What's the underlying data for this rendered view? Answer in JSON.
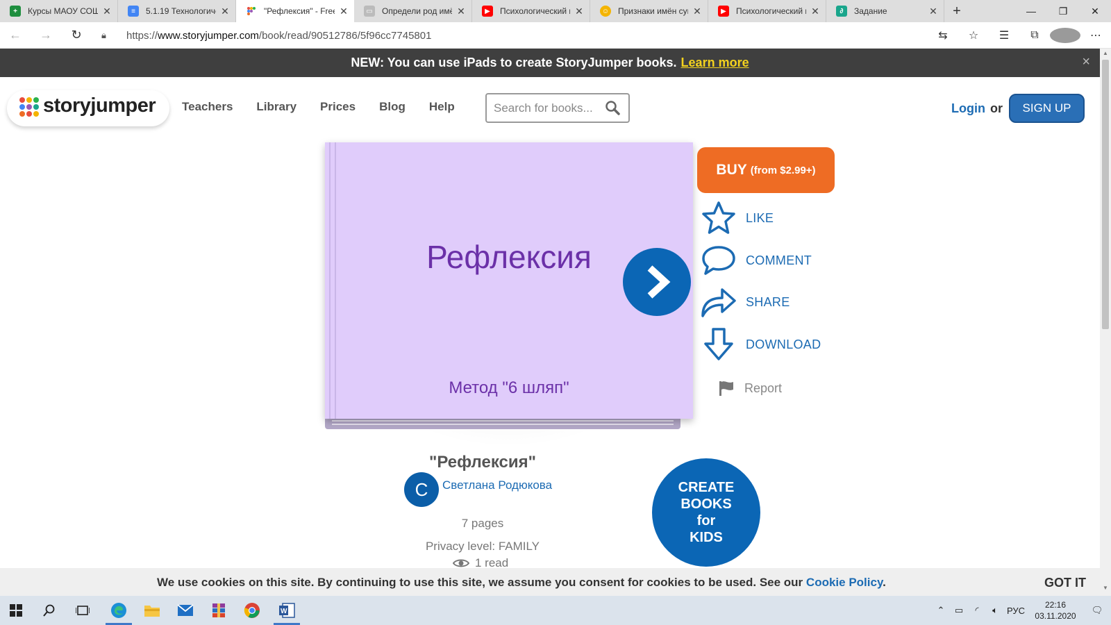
{
  "browser": {
    "tabs": [
      {
        "title": "Курсы МАОУ СОШ",
        "icon": "sheets-icon",
        "color": "#1e8e3e",
        "active": false
      },
      {
        "title": "5.1.19 Технологиче",
        "icon": "docs-icon",
        "color": "#4285f4",
        "active": false
      },
      {
        "title": "\"Рефлексия\" - Free",
        "icon": "storyjumper-icon",
        "color": "#e84c3d",
        "active": true
      },
      {
        "title": "Определи род имё",
        "icon": "page-icon",
        "color": "#888888",
        "active": false
      },
      {
        "title": "Психологический н",
        "icon": "youtube-icon",
        "color": "#ff0000",
        "active": false
      },
      {
        "title": "Признаки имён сущ",
        "icon": "smiley-icon",
        "color": "#f4b400",
        "active": false
      },
      {
        "title": "Психологический н",
        "icon": "youtube-icon",
        "color": "#ff0000",
        "active": false
      },
      {
        "title": "Задание",
        "icon": "task-icon",
        "color": "#1aa68c",
        "active": false
      }
    ],
    "url_prefix": "https://",
    "url_host": "www.storyjumper.com",
    "url_path": "/book/read/90512786/5f96cc7745801"
  },
  "banner": {
    "text": "NEW: You can use iPads to create StoryJumper books.",
    "link": "Learn more",
    "close": "×"
  },
  "header": {
    "logo_story": "story",
    "logo_jumper": "jumper",
    "nav": [
      "Teachers",
      "Library",
      "Prices",
      "Blog",
      "Help"
    ],
    "search_placeholder": "Search for books...",
    "login": "Login",
    "or": "or",
    "signup": "SIGN UP"
  },
  "book": {
    "cover_title": "Рефлексия",
    "cover_subtitle": "Метод \"6 шляп\"",
    "cover_color": "#e0ccfb",
    "name": "\"Рефлексия\"",
    "author_initial": "С",
    "author": "Светлана Родюкова",
    "pages": "7 pages",
    "privacy": "Privacy level: FAMILY",
    "reads": "1 read"
  },
  "actions": {
    "buy_main": "BUY",
    "buy_price": "(from $2.99+)",
    "like": "LIKE",
    "comment": "COMMENT",
    "share": "SHARE",
    "download": "DOWNLOAD",
    "report": "Report"
  },
  "create": {
    "line1": "CREATE",
    "line2": "BOOKS",
    "line3": "for",
    "line4": "KIDS"
  },
  "cookie": {
    "text": "We use cookies on this site. By continuing to use this site, we assume you consent for cookies to be used. See our",
    "link": "Cookie Policy",
    "after": ".",
    "button": "GOT IT"
  },
  "taskbar": {
    "lang": "РУС",
    "time": "22:16",
    "date": "03.11.2020"
  },
  "colors": {
    "brand_blue": "#1c6bb3",
    "buy_orange": "#ee6c24",
    "banner_bg": "#3f3f3f",
    "banner_link": "#f4d21e"
  }
}
